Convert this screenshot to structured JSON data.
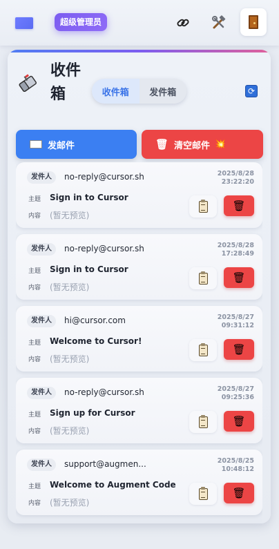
{
  "header": {
    "role_badge": "超级管理员",
    "icons": [
      "link-icon",
      "tools-icon",
      "door-icon"
    ]
  },
  "mailbox": {
    "title": "收件箱",
    "tabs": [
      {
        "label": "收件箱",
        "active": true
      },
      {
        "label": "发件箱",
        "active": false
      }
    ],
    "send_button": "发邮件",
    "clear_button": "清空邮件"
  },
  "labels": {
    "sender": "发件人",
    "subject": "主题",
    "content": "内容"
  },
  "mails": [
    {
      "sender": "no-reply@cursor.sh",
      "date": "2025/8/28",
      "time": "23:22:20",
      "subject": "Sign in to Cursor",
      "preview": "(暂无预览)"
    },
    {
      "sender": "no-reply@cursor.sh",
      "date": "2025/8/28",
      "time": "17:28:49",
      "subject": "Sign in to Cursor",
      "preview": "(暂无预览)"
    },
    {
      "sender": "hi@cursor.com",
      "date": "2025/8/27",
      "time": "09:31:12",
      "subject": "Welcome to Cursor!",
      "preview": "(暂无预览)"
    },
    {
      "sender": "no-reply@cursor.sh",
      "date": "2025/8/27",
      "time": "09:25:36",
      "subject": "Sign up for Cursor",
      "preview": "(暂无预览)"
    },
    {
      "sender": "support@augmen...",
      "date": "2025/8/25",
      "time": "10:48:12",
      "subject": "Welcome to Augment Code",
      "preview": "(暂无预览)"
    }
  ],
  "colors": {
    "primary": "#3b7ff2",
    "danger": "#ec4545",
    "badge": "#7b5cf0"
  }
}
